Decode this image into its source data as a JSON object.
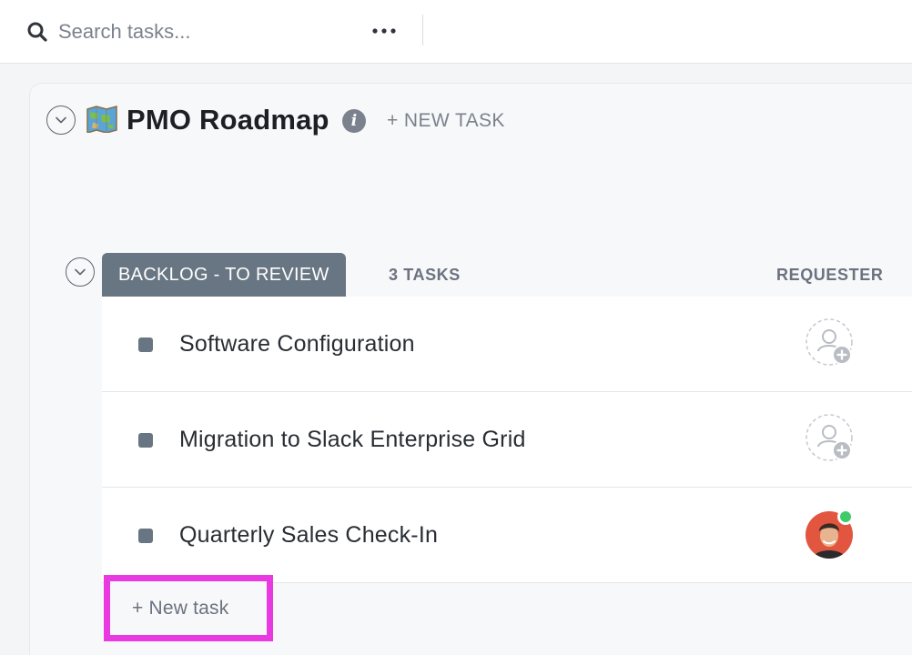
{
  "search": {
    "placeholder": "Search tasks...",
    "icon": "search-icon"
  },
  "toolbar": {
    "more_icon": "more-horizontal-icon"
  },
  "list": {
    "emoji": "world-map-emoji",
    "title": "PMO Roadmap",
    "info_icon": "info-icon",
    "new_task_label": "+ NEW TASK"
  },
  "group": {
    "status_label": "BACKLOG - TO REVIEW",
    "status_color": "#687582",
    "task_count": "3 TASKS",
    "column_requester": "REQUESTER",
    "tasks": [
      {
        "name": "Software Configuration",
        "requester": "unassigned-add-user-icon"
      },
      {
        "name": "Migration to Slack Enterprise Grid",
        "requester": "unassigned-add-user-icon"
      },
      {
        "name": "Quarterly Sales Check-In",
        "requester": "user-avatar",
        "online": true
      }
    ],
    "new_task_label": "+ New task"
  },
  "colors": {
    "accent_highlight": "#e83ae0",
    "online": "#3ecb6a",
    "muted_text": "#7c828d"
  }
}
